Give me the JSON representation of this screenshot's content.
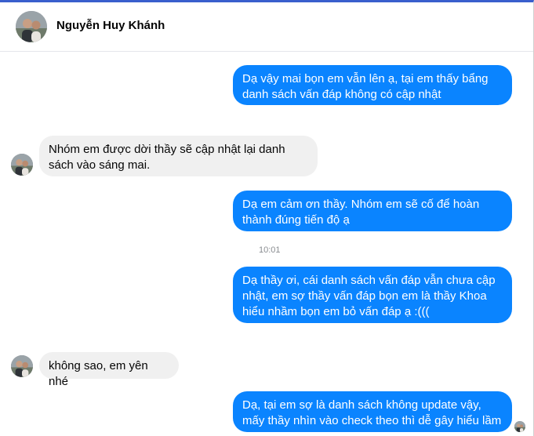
{
  "contact": {
    "name": "Nguyễn Huy Khánh",
    "avatar_icon": "profile-photo"
  },
  "messages": [
    {
      "dir": "out",
      "text": "Dạ vậy mai bọn em vẫn lên ạ, tại em thấy bẩng danh sách vấn đáp không có cập nhật"
    },
    {
      "dir": "in",
      "text": "Nhóm em được dời thầy sẽ cập nhật lại danh sách vào sáng mai."
    },
    {
      "dir": "out",
      "text": "Dạ em cảm ơn thầy. Nhóm em sẽ cố để hoàn thành đúng tiến độ ạ"
    },
    {
      "dir": "out",
      "text": "Dạ thầy ơi, cái danh sách vấn đáp vẫn chưa cập nhật, em sợ thầy vấn đáp bọn em là thầy Khoa hiểu nhầm bọn em bỏ vấn đáp ạ :((("
    },
    {
      "dir": "in",
      "text": "không sao, em yên nhé"
    },
    {
      "dir": "out",
      "text": "Dạ, tại em sợ là danh sách không update vậy, mấy thầy nhìn vào check theo thì dễ gây hiểu lầm"
    }
  ],
  "timestamp": "10:01",
  "colors": {
    "outgoing": "#0a84ff",
    "incoming": "#f0f0f0",
    "accent": "#3a5fcd"
  }
}
